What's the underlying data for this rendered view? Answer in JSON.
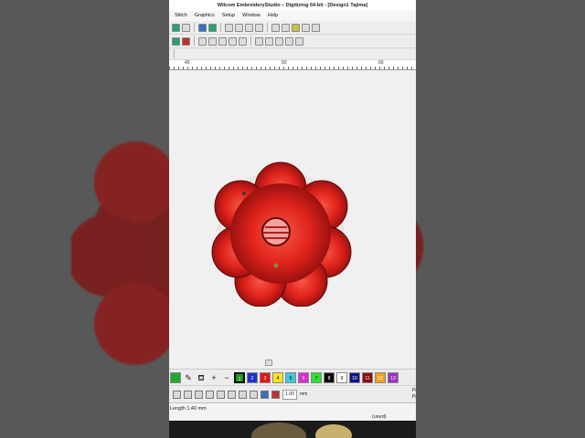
{
  "window": {
    "title": "Wilcom EmbroideryStudio – Digitizing 64-bit - [Design1     Tajima]"
  },
  "menu": [
    "Stitch",
    "Graphics",
    "Setup",
    "Window",
    "Help"
  ],
  "ruler": {
    "labels": [
      "40",
      "50",
      "60"
    ]
  },
  "color_palette": [
    {
      "label": "",
      "color": "#1fa82a"
    },
    {
      "label": "1",
      "color": "#10a020"
    },
    {
      "label": "2",
      "color": "#2030d0"
    },
    {
      "label": "3",
      "color": "#e01818"
    },
    {
      "label": "4",
      "color": "#f5e61a"
    },
    {
      "label": "5",
      "color": "#3cc8e0"
    },
    {
      "label": "6",
      "color": "#d830d0"
    },
    {
      "label": "7",
      "color": "#30e030"
    },
    {
      "label": "8",
      "color": "#0a0a0a"
    },
    {
      "label": "9",
      "color": "#ffffff"
    },
    {
      "label": "10",
      "color": "#10108a"
    },
    {
      "label": "11",
      "color": "#8a1010"
    },
    {
      "label": "12",
      "color": "#f0a020"
    },
    {
      "label": "13",
      "color": "#a030c0"
    }
  ],
  "active_swatch_index": 1,
  "property_bar": {
    "value": "1.00",
    "unit": "mm",
    "side_labels": [
      "Po",
      "Po"
    ]
  },
  "status": {
    "stitch_length": "Length  1.40 mm",
    "used": "(used)"
  }
}
